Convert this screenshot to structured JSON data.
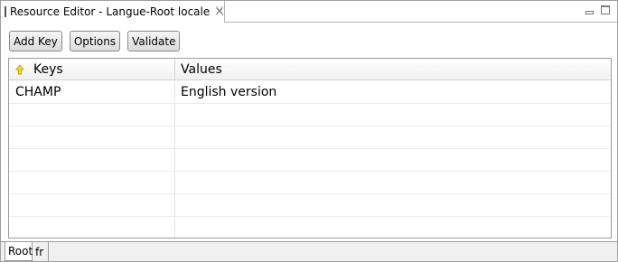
{
  "editor_tab": {
    "icon": "i18n-icon",
    "icon_text": "i18n",
    "title": "Resource Editor - Langue-Root locale",
    "close_icon": "close-icon"
  },
  "window_controls": {
    "minimize_icon": "minimize-icon",
    "maximize_icon": "maximize-icon"
  },
  "toolbar": {
    "add_key_label": "Add Key",
    "options_label": "Options",
    "validate_label": "Validate"
  },
  "table": {
    "sort_icon": "sort-up-arrow-icon",
    "sort_icon_color": "#c8a400",
    "columns": [
      "Keys",
      "Values"
    ],
    "rows": [
      {
        "key": "CHAMP",
        "value": "English version"
      },
      {
        "key": "",
        "value": ""
      },
      {
        "key": "",
        "value": ""
      },
      {
        "key": "",
        "value": ""
      },
      {
        "key": "",
        "value": ""
      },
      {
        "key": "",
        "value": ""
      },
      {
        "key": "",
        "value": ""
      }
    ]
  },
  "locale_tabs": {
    "items": [
      "Root",
      "fr"
    ],
    "selected": "Root"
  }
}
